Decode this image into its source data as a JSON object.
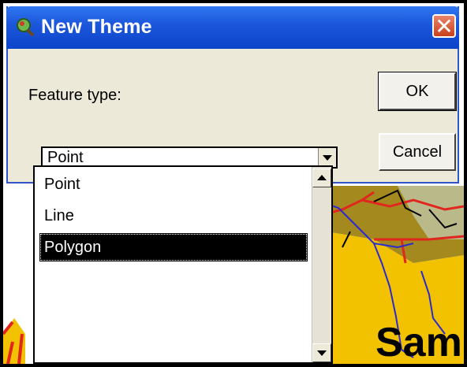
{
  "dialog": {
    "title": "New Theme",
    "feature_type_label": "Feature type:",
    "ok_label": "OK",
    "cancel_label": "Cancel",
    "combo_value": "Point",
    "options": [
      "Point",
      "Line",
      "Polygon"
    ],
    "selected_option": "Polygon"
  },
  "map": {
    "label": "Sam"
  },
  "icons": {
    "title": "magnifier-icon",
    "close": "close-icon",
    "dropdown": "chevron-down-icon",
    "scroll_up": "scroll-up-arrow-icon",
    "scroll_down": "scroll-down-arrow-icon"
  },
  "colors": {
    "titlebar": "#0b43c9",
    "dialog_bg": "#ece9d8",
    "close_button": "#c9401b",
    "selection": "#000000",
    "map_yellow": "#f2c200",
    "map_olive": "#a48a1e",
    "map_sage": "#b9b98a"
  }
}
